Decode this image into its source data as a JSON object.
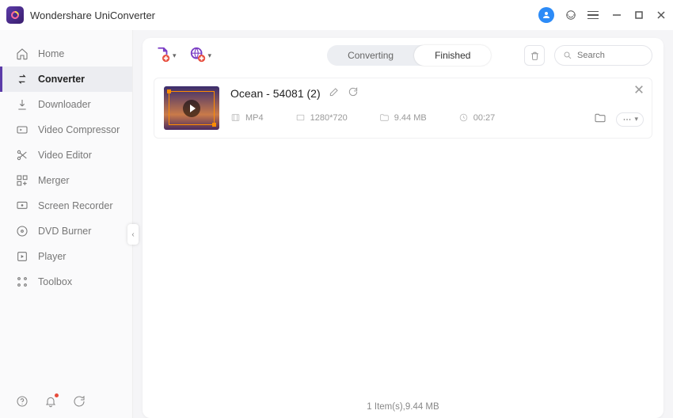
{
  "app": {
    "title": "Wondershare UniConverter"
  },
  "sidebar": {
    "items": [
      {
        "label": "Home"
      },
      {
        "label": "Converter"
      },
      {
        "label": "Downloader"
      },
      {
        "label": "Video Compressor"
      },
      {
        "label": "Video Editor"
      },
      {
        "label": "Merger"
      },
      {
        "label": "Screen Recorder"
      },
      {
        "label": "DVD Burner"
      },
      {
        "label": "Player"
      },
      {
        "label": "Toolbox"
      }
    ],
    "active_index": 1
  },
  "toolbar": {
    "tabs": {
      "converting": "Converting",
      "finished": "Finished"
    },
    "active_tab": "finished",
    "search_placeholder": "Search"
  },
  "file": {
    "title": "Ocean - 54081 (2)",
    "format": "MP4",
    "resolution": "1280*720",
    "size": "9.44 MB",
    "duration": "00:27"
  },
  "status": {
    "text": "1 Item(s),9.44 MB"
  },
  "colors": {
    "accent": "#5b3ba8"
  }
}
